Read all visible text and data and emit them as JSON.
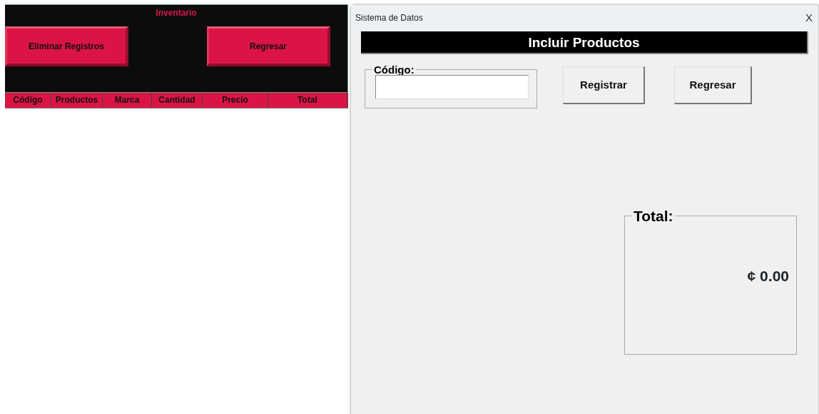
{
  "sheet": {
    "title": "Inventario",
    "buttons": [
      "Eliminar Registros",
      "Regresar"
    ],
    "columns": [
      "Código",
      "Productos",
      "Marca",
      "Cantidad",
      "Precio",
      "Total"
    ]
  },
  "dialog": {
    "title": "Sistema de Datos",
    "close": "X",
    "heading": "Incluir Productos",
    "code_field": {
      "label": "Código:"
    },
    "buttons": [
      "Registrar",
      "Regresar"
    ],
    "total": {
      "label": "Total:",
      "value": "¢ 0.00"
    }
  }
}
